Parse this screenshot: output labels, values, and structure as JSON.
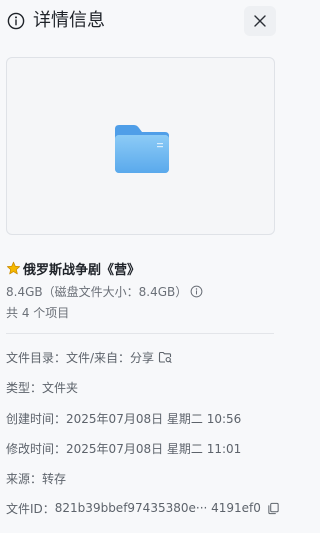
{
  "header": {
    "title": "详情信息"
  },
  "file": {
    "name": "俄罗斯战争剧《营》",
    "size_text": "8.4GB（磁盘文件大小：8.4GB）",
    "count_text": "共 4 个项目"
  },
  "details": {
    "directory_label": "文件目录：",
    "directory_value": "文件/来自：分享",
    "type_label": "类型：",
    "type_value": "文件夹",
    "created_label": "创建时间：",
    "created_value": "2025年07月08日 星期二 10:56",
    "modified_label": "修改时间：",
    "modified_value": "2025年07月08日 星期二 11:01",
    "source_label": "来源：",
    "source_value": "转存",
    "id_label": "文件ID：",
    "id_value": "821b39bbef97435380e··· 4191ef0"
  },
  "icons": {
    "info": "info-icon",
    "close": "close-icon",
    "folder": "folder-icon",
    "star": "star-icon",
    "size_info": "info-icon",
    "open_folder": "folder-link-icon",
    "copy": "copy-icon"
  },
  "colors": {
    "folder_main": "#6ab4ef",
    "folder_tab": "#4f9ee8",
    "star": "#f5b800",
    "text_primary": "#1f2329",
    "text_secondary": "#6b7078"
  }
}
